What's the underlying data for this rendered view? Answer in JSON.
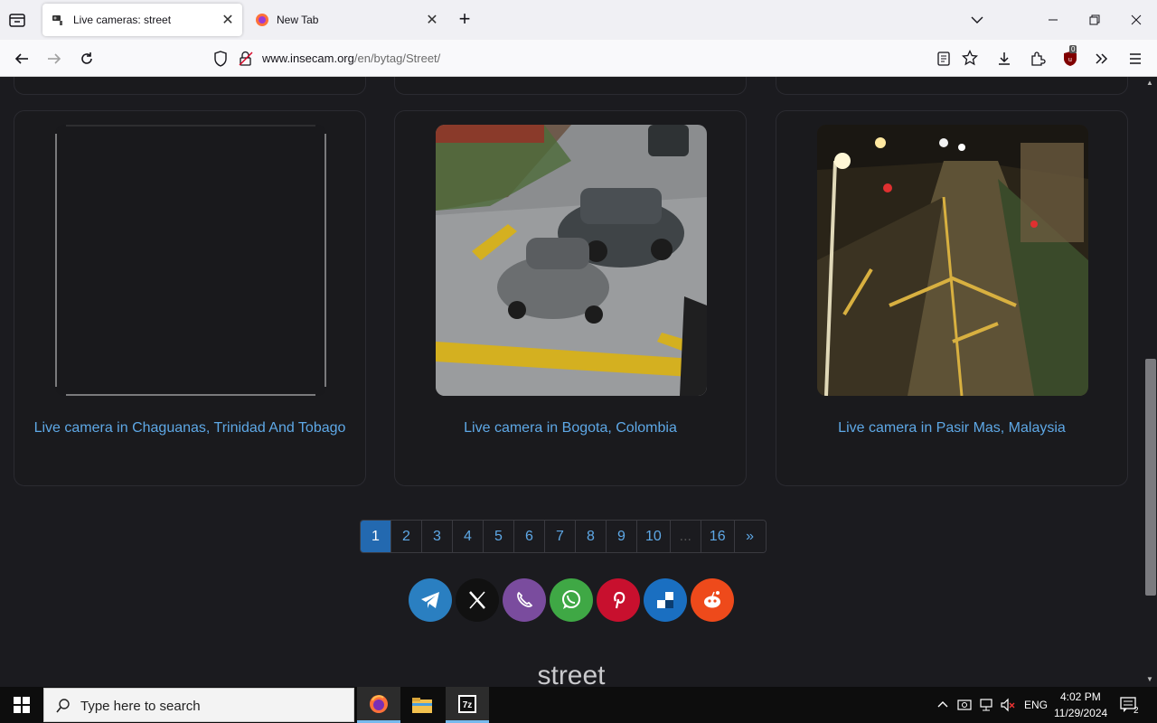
{
  "browser": {
    "tabs": [
      {
        "title": "Live cameras: street",
        "active": true
      },
      {
        "title": "New Tab",
        "active": false
      }
    ],
    "url_host": "www.insecam.org",
    "url_path": "/en/bytag/Street/",
    "notification_badge": "0"
  },
  "cameras": [
    {
      "label": "Live camera in Chaguanas, Trinidad And Tobago"
    },
    {
      "label": "Live camera in Bogota, Colombia"
    },
    {
      "label": "Live camera in Pasir Mas, Malaysia"
    }
  ],
  "pagination": {
    "pages": [
      "1",
      "2",
      "3",
      "4",
      "5",
      "6",
      "7",
      "8",
      "9",
      "10",
      "...",
      "16",
      "»"
    ],
    "active": "1"
  },
  "share": [
    {
      "name": "telegram",
      "color": "#2a7fc1"
    },
    {
      "name": "x",
      "color": "#111111"
    },
    {
      "name": "viber",
      "color": "#7a4c9e"
    },
    {
      "name": "whatsapp",
      "color": "#3fa845"
    },
    {
      "name": "pinterest",
      "color": "#c8102e"
    },
    {
      "name": "delicious",
      "color": "#1a6fc1"
    },
    {
      "name": "reddit",
      "color": "#ee4a1b"
    }
  ],
  "footer_tag": "street",
  "taskbar": {
    "search_placeholder": "Type here to search",
    "language": "ENG",
    "time": "4:02 PM",
    "date": "11/29/2024",
    "notifications": "2"
  }
}
